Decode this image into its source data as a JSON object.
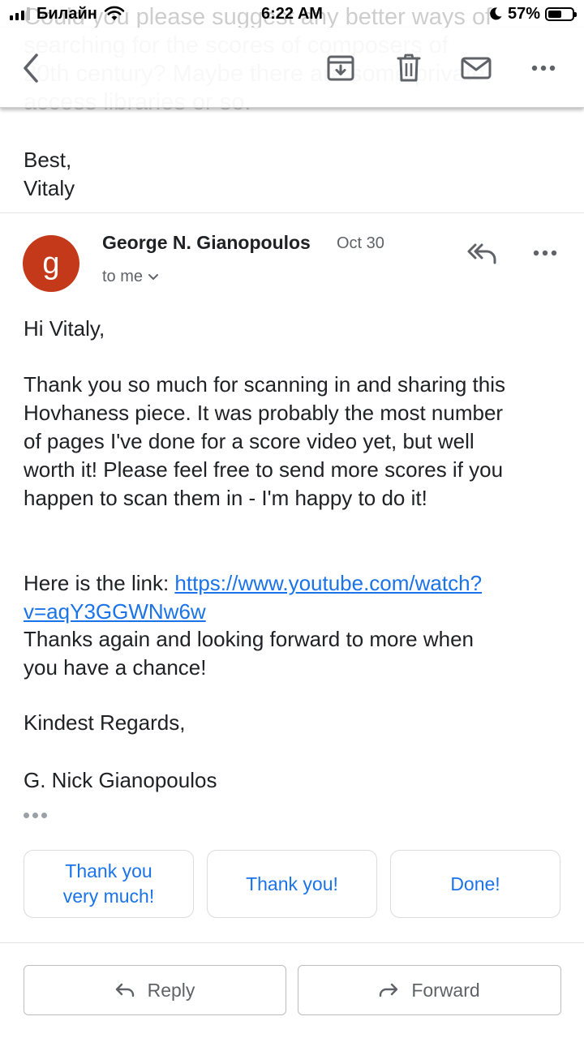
{
  "status_bar": {
    "carrier": "Билайн",
    "time": "6:22 AM",
    "battery": "57%",
    "battery_level": 0.57
  },
  "toolbar": {
    "icons": [
      "back-arrow-icon",
      "archive-icon",
      "trash-icon",
      "mail-icon",
      "more-icon"
    ]
  },
  "previous_message": {
    "faded_text": "Could you please suggest any better ways of\nsearching for the scores of composers of\n20th century? Maybe there are some private\naccess libraries or so.",
    "sign_off": "Best,",
    "signature": "Vitaly"
  },
  "message": {
    "avatar_letter": "g",
    "sender": "George N. Gianopoulos",
    "date": "Oct 30",
    "recipient": "to me",
    "greeting": "Hi Vitaly,",
    "paragraph1": "Thank you so much for scanning in and sharing this\nHovhaness piece. It was probably the most number\nof pages I've done for a score video yet, but well\nworth it! Please feel free to send more scores if you\nhappen to scan them in - I'm happy to do it!",
    "link_prefix": "Here is the link: ",
    "link_part1": "https://www.youtube.com/watch?",
    "link_part2": "v=aqY3GGWNw6w",
    "paragraph2": "Thanks again and looking forward to more when\nyou have a chance!",
    "closing": "Kindest Regards,",
    "signature": "G. Nick Gianopoulos"
  },
  "smart_replies": [
    "Thank you very much!",
    "Thank you!",
    "Done!"
  ],
  "actions": {
    "reply": "Reply",
    "forward": "Forward"
  },
  "colors": {
    "link": "#1a73e8",
    "avatar": "#c5391b"
  }
}
